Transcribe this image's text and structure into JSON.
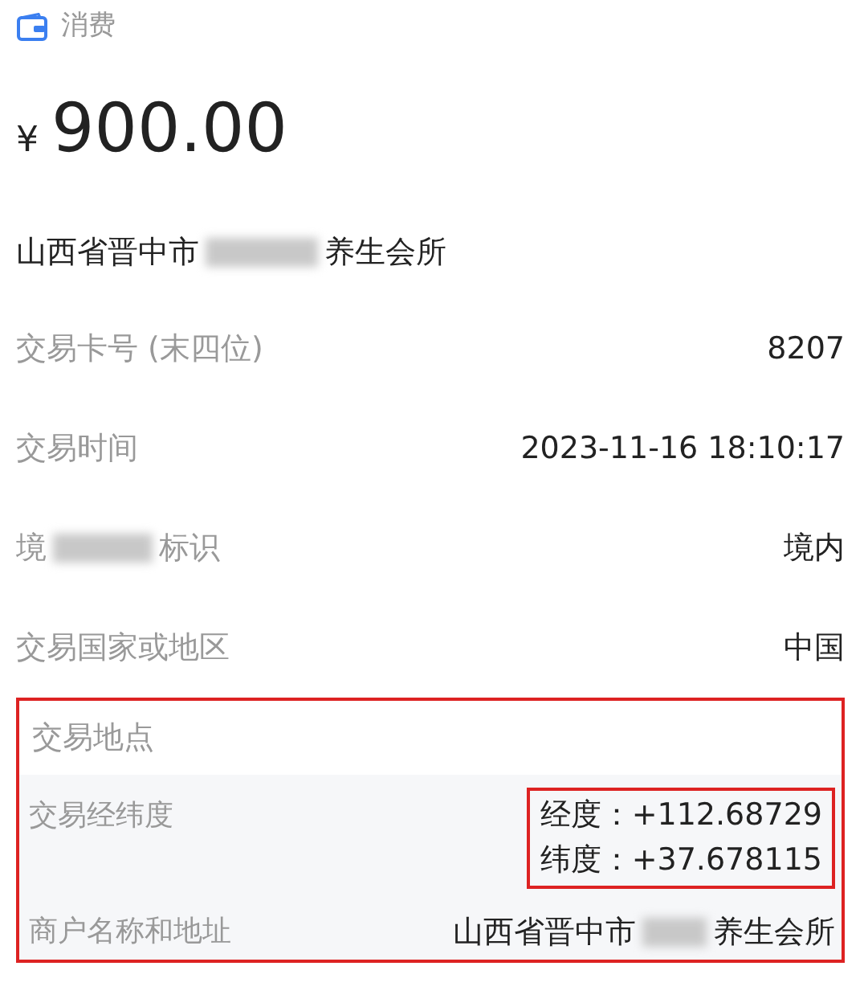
{
  "header": {
    "label": "消费"
  },
  "amount": {
    "currency": "¥",
    "value": "900.00"
  },
  "merchant": {
    "parts": [
      "山西省晋中市",
      "养生会所"
    ]
  },
  "rows": [
    {
      "label_parts": [
        "交易卡号 (末四位)"
      ],
      "value": "8207"
    },
    {
      "label_parts": [
        "交易时间"
      ],
      "value": "2023-11-16 18:10:17"
    },
    {
      "label_parts": [
        "境",
        "标识"
      ],
      "value": "境内"
    },
    {
      "label_parts": [
        "交易国家或地区"
      ],
      "value": "中国"
    }
  ],
  "location_section": {
    "title": "交易地点",
    "highlighted": true,
    "details": [
      {
        "kind": "coords",
        "label": "交易经纬度",
        "lines": [
          "经度：+112.68729",
          "纬度：+37.678115"
        ],
        "highlighted": true
      },
      {
        "kind": "text",
        "label": "商户名称和地址",
        "value_parts": [
          "山西省晋中市",
          "养生会所"
        ]
      }
    ]
  }
}
